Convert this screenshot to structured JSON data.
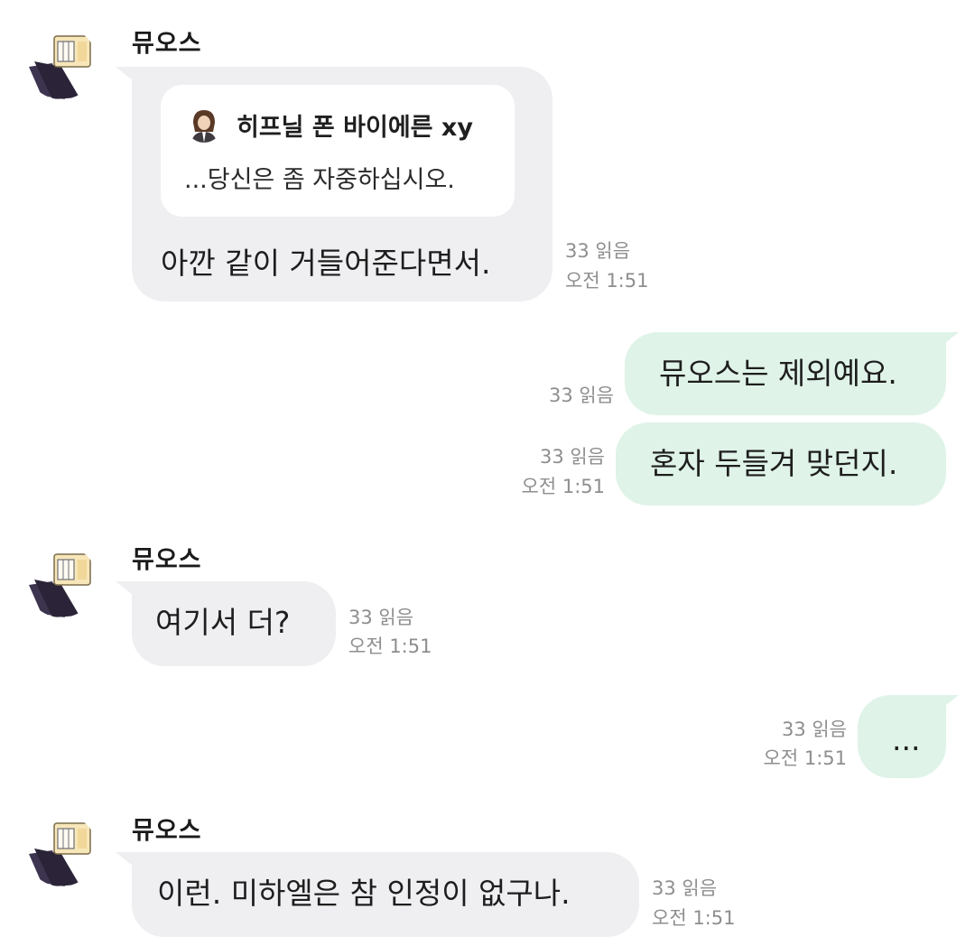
{
  "colors": {
    "incoming_bubble": "#efeff2",
    "outgoing_bubble": "#dff3e8",
    "meta_text": "#8e8e8e",
    "background": "#ffffff"
  },
  "messages": [
    {
      "direction": "incoming",
      "sender": "뮤오스",
      "avatar": "avatar-icon",
      "reply_quote": {
        "author": "히프닐 폰 바이에른 xy",
        "text": "...당신은 좀 자중하십시오."
      },
      "text": "아깐 같이 거들어준다면서.",
      "read": "33 읽음",
      "time": "오전 1:51"
    },
    {
      "direction": "outgoing",
      "text": "뮤오스는 제외예요.",
      "read": "33 읽음",
      "time": ""
    },
    {
      "direction": "outgoing",
      "text": "혼자 두들겨 맞던지.",
      "read": "33 읽음",
      "time": "오전 1:51"
    },
    {
      "direction": "incoming",
      "sender": "뮤오스",
      "avatar": "avatar-icon",
      "text": "여기서 더?",
      "read": "33 읽음",
      "time": "오전 1:51"
    },
    {
      "direction": "outgoing",
      "text": "...",
      "read": "33 읽음",
      "time": "오전 1:51"
    },
    {
      "direction": "incoming",
      "sender": "뮤오스",
      "avatar": "avatar-icon",
      "text": "이런. 미하엘은 참 인정이 없구나.",
      "read": "33 읽음",
      "time": "오전 1:51"
    }
  ]
}
